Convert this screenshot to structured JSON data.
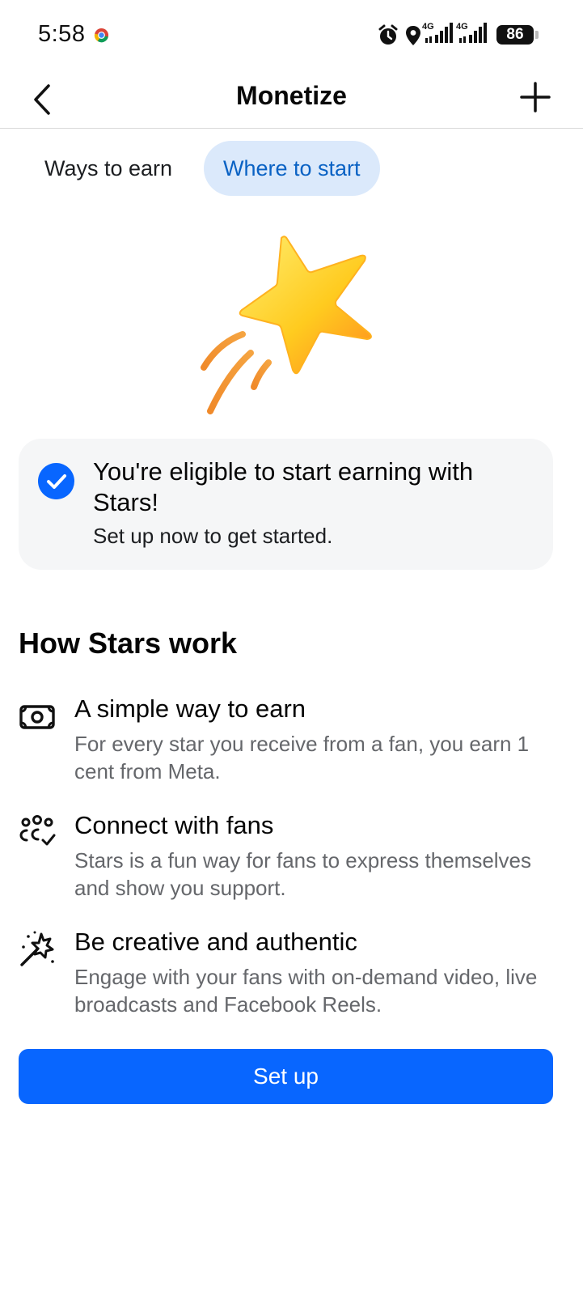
{
  "status_bar": {
    "time": "5:58",
    "network_1": "4G",
    "network_2": "4G",
    "battery": "86"
  },
  "top_bar": {
    "title": "Monetize"
  },
  "tabs": [
    {
      "label": "Ways to earn",
      "selected": false
    },
    {
      "label": "Where to start",
      "selected": true
    }
  ],
  "eligible_card": {
    "title": "You're eligible to start earning with Stars!",
    "subtitle": "Set up now to get started."
  },
  "section": {
    "title": "How Stars work"
  },
  "features": [
    {
      "icon": "money-icon",
      "title": "A simple way to earn",
      "description": "For every star you receive from a fan, you earn 1 cent from Meta."
    },
    {
      "icon": "people-check-icon",
      "title": "Connect with fans",
      "description": "Stars is a fun way for fans to express themselves and show you support."
    },
    {
      "icon": "magic-wand-icon",
      "title": "Be creative and authentic",
      "description": "Engage with your fans with on-demand video, live broadcasts and Facebook Reels."
    }
  ],
  "setup_button": {
    "label": "Set up"
  },
  "colors": {
    "accent": "#0866ff",
    "tab_selected_bg": "#dbe9fb",
    "tab_selected_text": "#0a62c4",
    "card_bg": "#f5f6f7",
    "secondary_text": "#65676b"
  }
}
